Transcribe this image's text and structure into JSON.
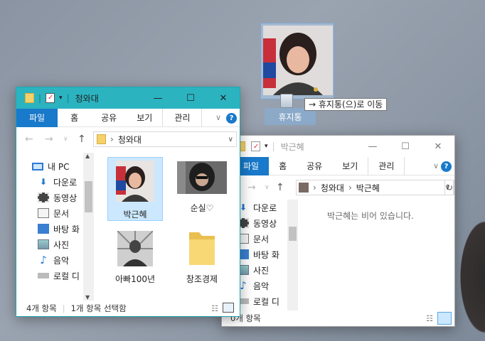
{
  "desktop": {
    "drag_label": "휴지통",
    "drag_tooltip": "→ 휴지통(으)로 이동"
  },
  "window1": {
    "title": "청와대",
    "tabs": [
      "파일",
      "홈",
      "공유",
      "보기",
      "관리"
    ],
    "breadcrumb": "청와대",
    "nav_items": [
      {
        "label": "내 PC",
        "icon": "pc-icon"
      },
      {
        "label": "다운로",
        "icon": "download-icon"
      },
      {
        "label": "동영상",
        "icon": "video-icon"
      },
      {
        "label": "문서",
        "icon": "document-icon"
      },
      {
        "label": "바탕 화",
        "icon": "desktop-icon"
      },
      {
        "label": "사진",
        "icon": "pictures-icon"
      },
      {
        "label": "음악",
        "icon": "music-icon"
      },
      {
        "label": "로컬 디",
        "icon": "drive-icon"
      }
    ],
    "files": [
      {
        "name": "박근혜",
        "type": "photo",
        "selected": true
      },
      {
        "name": "순실♡",
        "type": "photo",
        "selected": false
      },
      {
        "name": "아빠100년",
        "type": "photo",
        "selected": false
      },
      {
        "name": "창조경제",
        "type": "folder",
        "selected": false
      }
    ],
    "status_count": "4개 항목",
    "status_selected": "1개 항목 선택함"
  },
  "window2": {
    "title": "박근혜",
    "tabs": [
      "파일",
      "홈",
      "공유",
      "보기",
      "관리"
    ],
    "breadcrumb": [
      "청와대",
      "박근혜"
    ],
    "nav_items": [
      {
        "label": "다운로",
        "icon": "download-icon"
      },
      {
        "label": "동영상",
        "icon": "video-icon"
      },
      {
        "label": "문서",
        "icon": "document-icon"
      },
      {
        "label": "바탕 화",
        "icon": "desktop-icon"
      },
      {
        "label": "사진",
        "icon": "pictures-icon"
      },
      {
        "label": "음악",
        "icon": "music-icon"
      },
      {
        "label": "로컬 디",
        "icon": "drive-icon"
      }
    ],
    "empty_message": "박근혜는 비어 있습니다.",
    "status_count": "0개 항목"
  },
  "colors": {
    "titlebar_active": "#2bb3c0",
    "tab_active": "#1979ca",
    "selection": "#cce8ff",
    "help": "#1979ca"
  }
}
